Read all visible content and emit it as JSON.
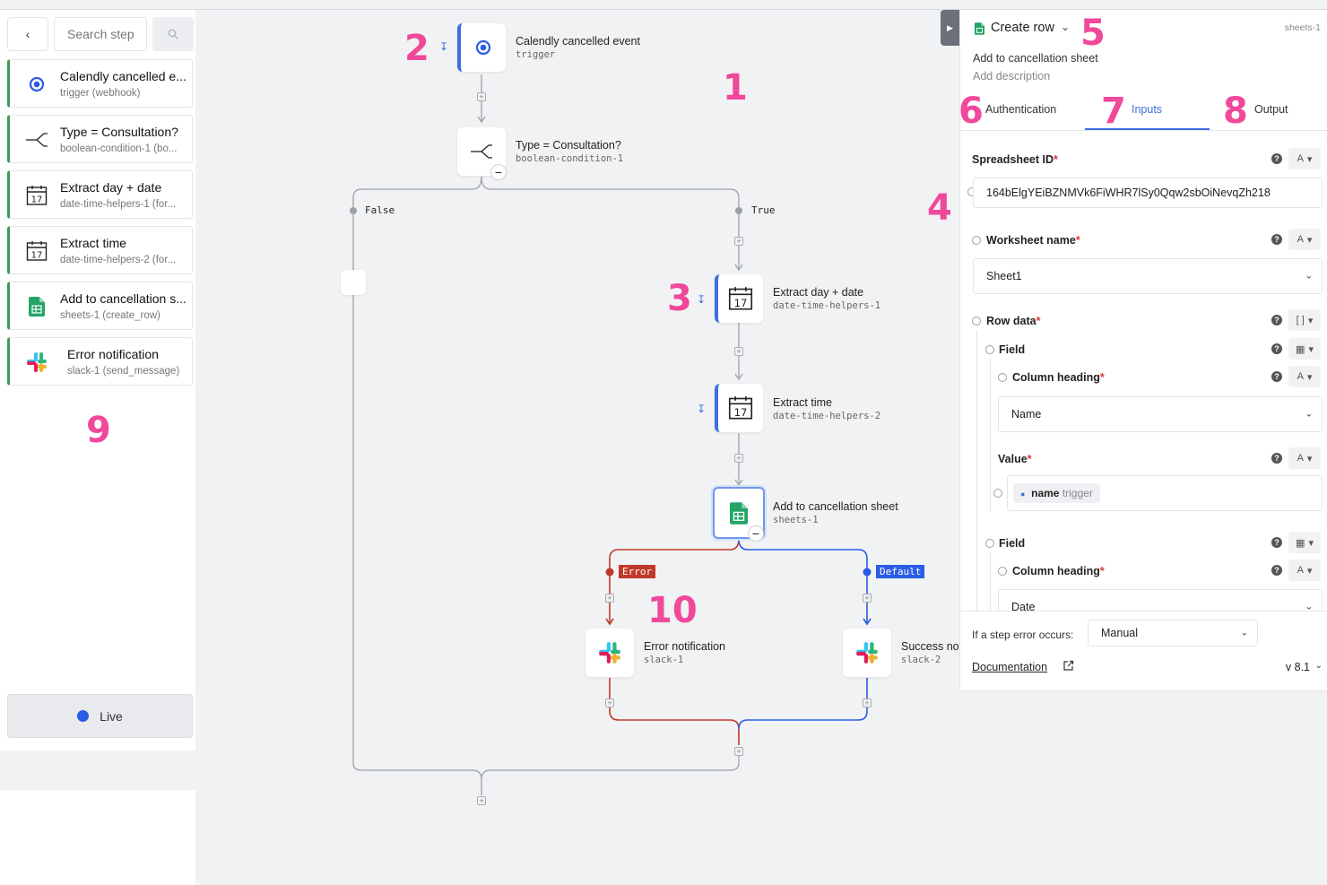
{
  "sidebar": {
    "search_placeholder": "Search steps",
    "steps": [
      {
        "title": "Calendly cancelled e...",
        "sub": "trigger (webhook)",
        "icon": "calendly-icon"
      },
      {
        "title": "Type = Consultation?",
        "sub": "boolean-condition-1 (bo...",
        "icon": "branch-icon"
      },
      {
        "title": "Extract day + date",
        "sub": "date-time-helpers-1 (for...",
        "icon": "calendar-icon"
      },
      {
        "title": "Extract time",
        "sub": "date-time-helpers-2 (for...",
        "icon": "calendar-icon"
      },
      {
        "title": "Add to cancellation s...",
        "sub": "sheets-1 (create_row)",
        "icon": "sheets-icon"
      },
      {
        "title": "Error notification",
        "sub": "slack-1 (send_message)",
        "icon": "slack-icon"
      }
    ],
    "live_label": "Live"
  },
  "flow": {
    "trigger": {
      "title": "Calendly cancelled event",
      "sub": "trigger"
    },
    "condition": {
      "title": "Type = Consultation?",
      "sub": "boolean-condition-1"
    },
    "branch_false": "False",
    "branch_true": "True",
    "extract_date": {
      "title": "Extract day + date",
      "sub": "date-time-helpers-1"
    },
    "extract_time": {
      "title": "Extract time",
      "sub": "date-time-helpers-2"
    },
    "sheet": {
      "title": "Add to cancellation sheet",
      "sub": "sheets-1"
    },
    "tag_error": "Error",
    "tag_default": "Default",
    "error_notif": {
      "title": "Error notification",
      "sub": "slack-1"
    },
    "success_notif": {
      "title": "Success notification",
      "sub": "slack-2"
    },
    "calendar_day": "17"
  },
  "annotations": {
    "a1": "1",
    "a2": "2",
    "a3": "3",
    "a4": "4",
    "a5": "5",
    "a6": "6",
    "a7": "7",
    "a8": "8",
    "a9": "9",
    "a10": "10"
  },
  "panel": {
    "action": "Create row",
    "step_id": "sheets-1",
    "step_name": "Add to cancellation sheet",
    "description_placeholder": "Add description",
    "tabs": {
      "auth": "Authentication",
      "inputs": "Inputs",
      "output": "Output"
    },
    "fields": {
      "spreadsheet_id_label": "Spreadsheet ID",
      "spreadsheet_id_value": "164bElgYEiBZNMVk6FiWHR7lSy0Qqw2sbOiNevqZh218",
      "worksheet_label": "Worksheet name",
      "worksheet_value": "Sheet1",
      "row_data_label": "Row data",
      "field_label": "Field",
      "column_heading_label": "Column heading",
      "column_heading_1": "Name",
      "value_label": "Value",
      "value_pill_name": "name",
      "value_pill_source": "trigger",
      "column_heading_2": "Date",
      "type_text": "A",
      "type_list": "[ ]",
      "required": "*"
    },
    "footer": {
      "error_label": "If a step error occurs:",
      "error_value": "Manual",
      "doc_link": "Documentation",
      "version": "v 8.1"
    }
  },
  "colors": {
    "green": "#3f9a5a",
    "blue": "#3b6fe0",
    "error": "#c0392b",
    "annotation": "#f0489a"
  }
}
